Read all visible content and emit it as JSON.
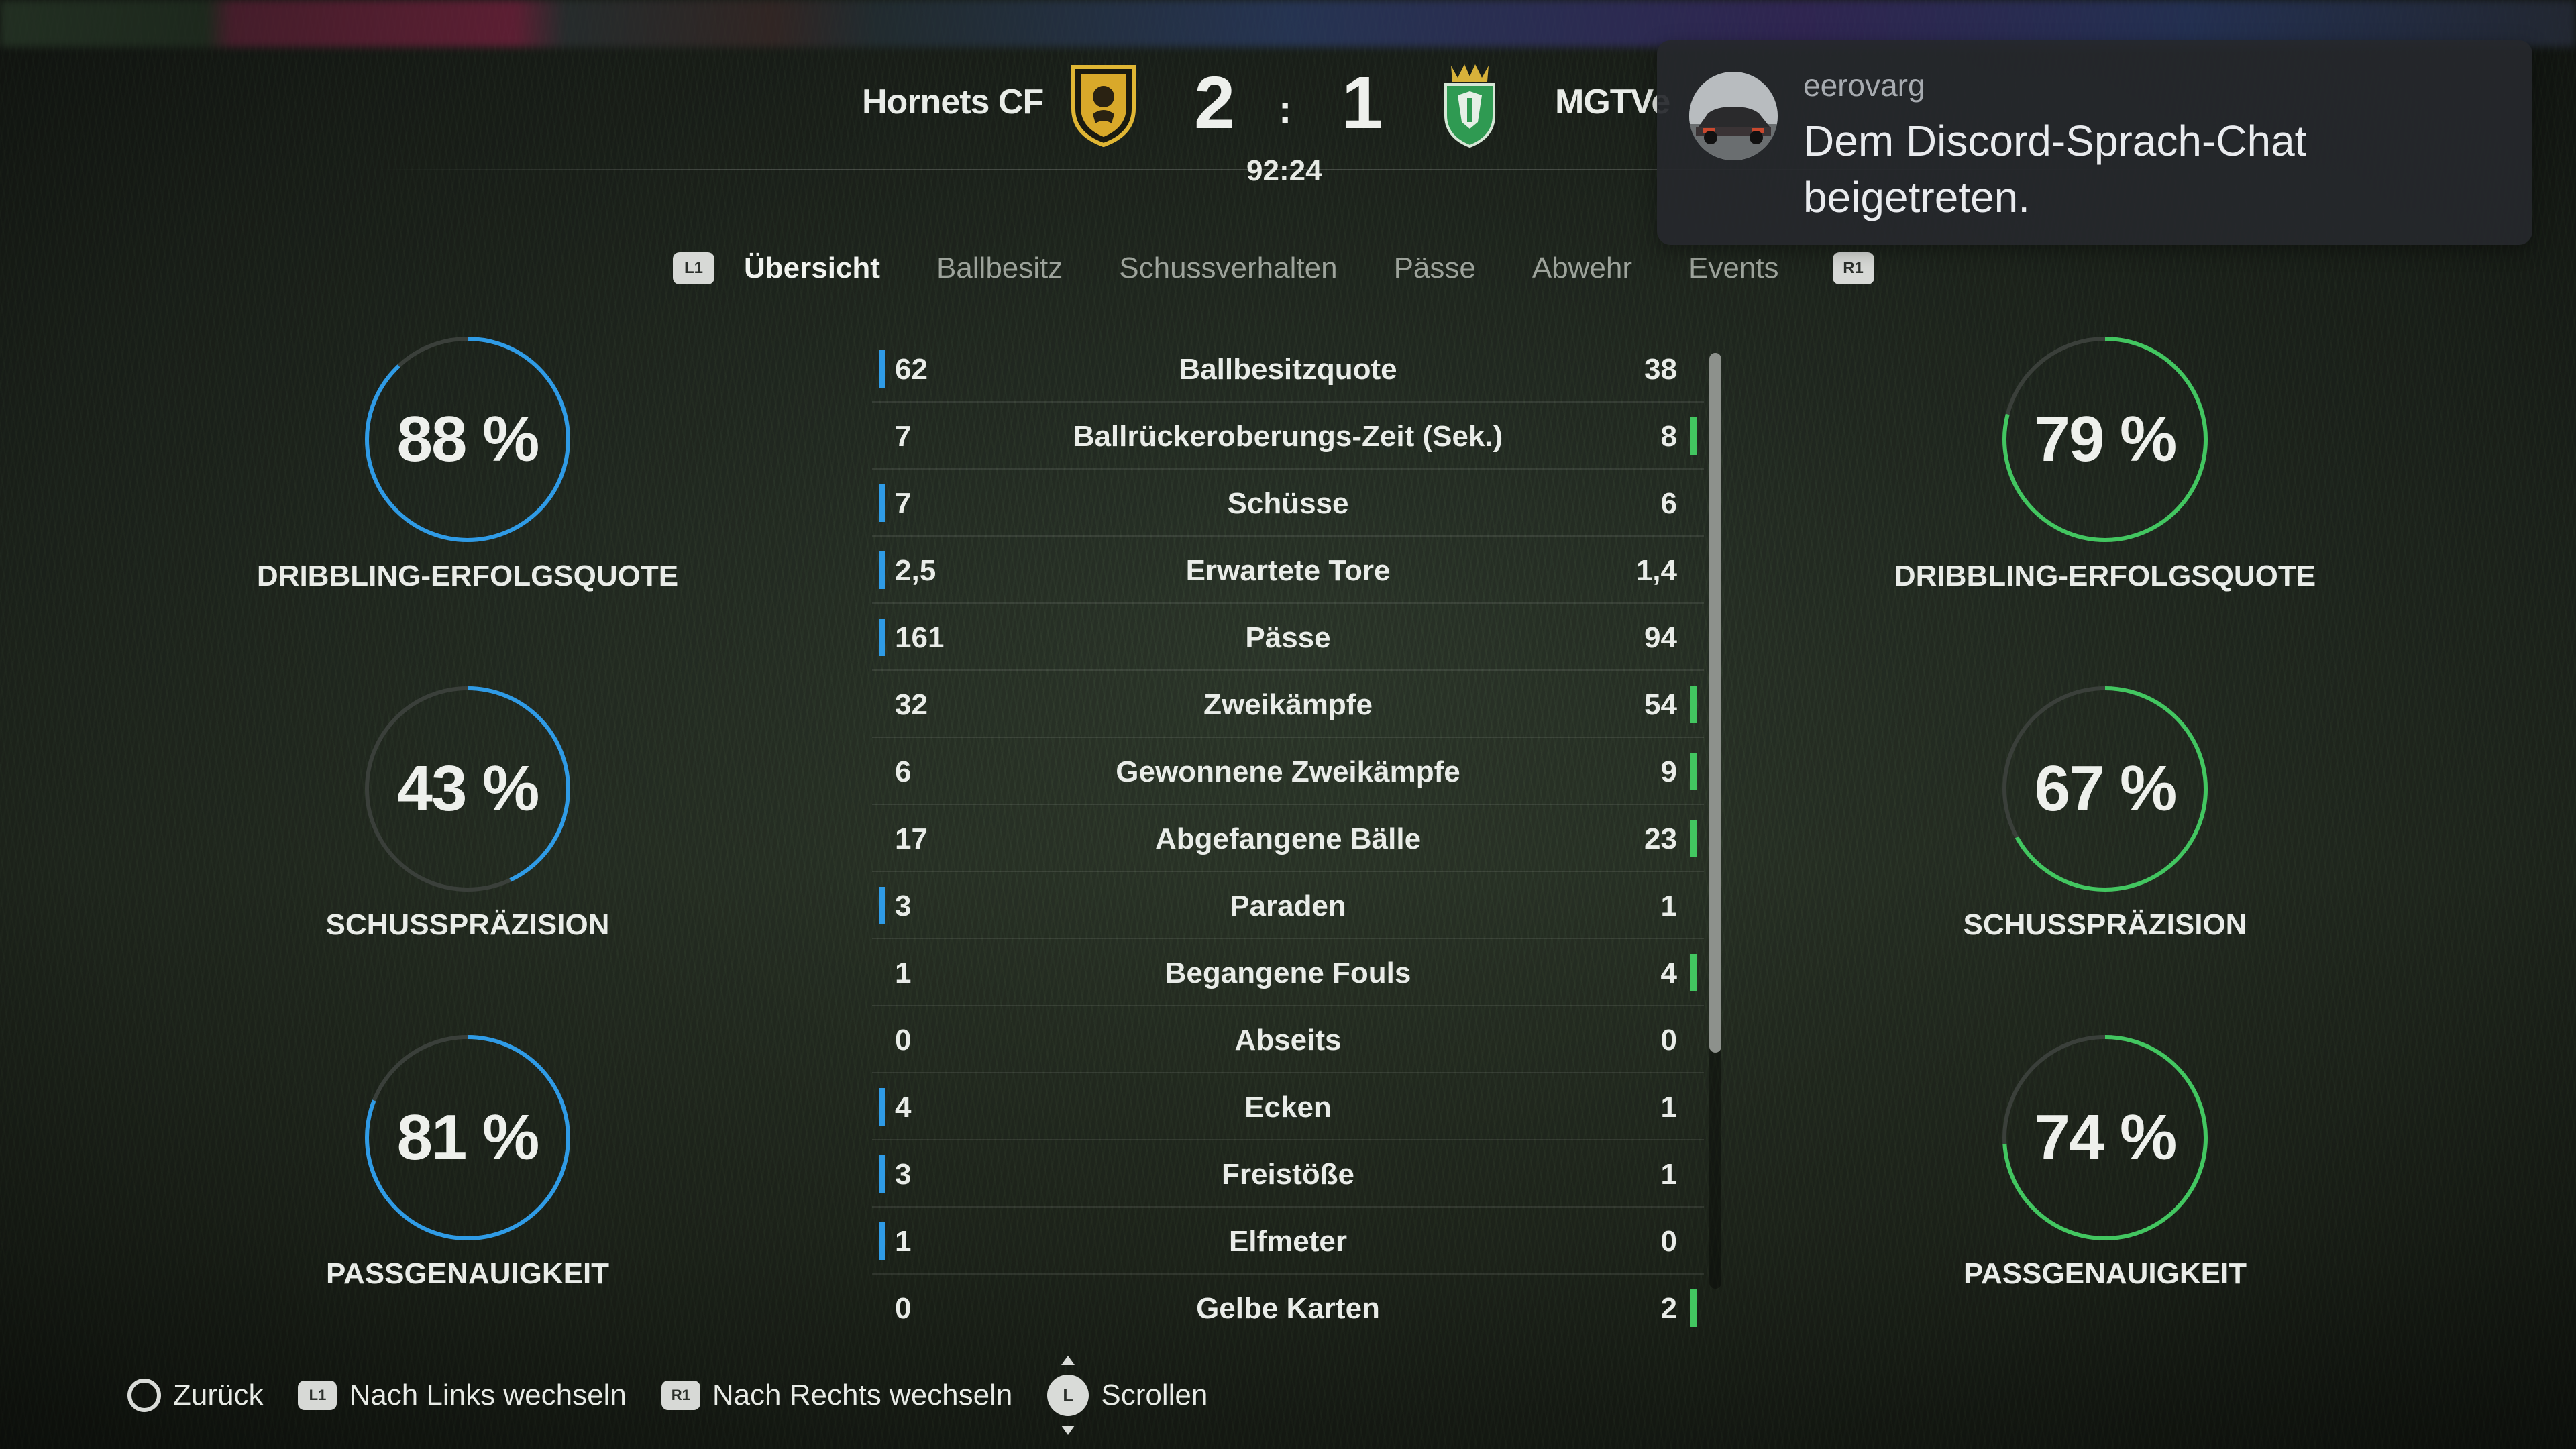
{
  "match": {
    "home_team": "Hornets CF",
    "away_team": "MGTVe",
    "home_score": "2",
    "separator": ":",
    "away_score": "1",
    "clock": "92:24"
  },
  "tabs": {
    "left_button": "L1",
    "right_button": "R1",
    "items": [
      "Übersicht",
      "Ballbesitz",
      "Schussverhalten",
      "Pässe",
      "Abwehr",
      "Events"
    ],
    "active_index": 0
  },
  "stats": [
    {
      "label": "Ballbesitzquote",
      "home": "62",
      "away": "38",
      "leader": "home"
    },
    {
      "label": "Ballrückeroberungs-Zeit (Sek.)",
      "home": "7",
      "away": "8",
      "leader": "away"
    },
    {
      "label": "Schüsse",
      "home": "7",
      "away": "6",
      "leader": "home"
    },
    {
      "label": "Erwartete Tore",
      "home": "2,5",
      "away": "1,4",
      "leader": "home"
    },
    {
      "label": "Pässe",
      "home": "161",
      "away": "94",
      "leader": "home"
    },
    {
      "label": "Zweikämpfe",
      "home": "32",
      "away": "54",
      "leader": "away"
    },
    {
      "label": "Gewonnene Zweikämpfe",
      "home": "6",
      "away": "9",
      "leader": "away"
    },
    {
      "label": "Abgefangene Bälle",
      "home": "17",
      "away": "23",
      "leader": "away"
    },
    {
      "label": "Paraden",
      "home": "3",
      "away": "1",
      "leader": "home"
    },
    {
      "label": "Begangene Fouls",
      "home": "1",
      "away": "4",
      "leader": "away"
    },
    {
      "label": "Abseits",
      "home": "0",
      "away": "0",
      "leader": "none"
    },
    {
      "label": "Ecken",
      "home": "4",
      "away": "1",
      "leader": "home"
    },
    {
      "label": "Freistöße",
      "home": "3",
      "away": "1",
      "leader": "home"
    },
    {
      "label": "Elfmeter",
      "home": "1",
      "away": "0",
      "leader": "home"
    },
    {
      "label": "Gelbe Karten",
      "home": "0",
      "away": "2",
      "leader": "away"
    }
  ],
  "rings": {
    "home": [
      {
        "pct": "88 %",
        "value": 0.88,
        "label": "DRIBBLING-ERFOLGSQUOTE"
      },
      {
        "pct": "43 %",
        "value": 0.43,
        "label": "SCHUSSPRÄZISION"
      },
      {
        "pct": "81 %",
        "value": 0.81,
        "label": "PASSGENAUIGKEIT"
      }
    ],
    "away": [
      {
        "pct": "79 %",
        "value": 0.79,
        "label": "DRIBBLING-ERFOLGSQUOTE"
      },
      {
        "pct": "67 %",
        "value": 0.67,
        "label": "SCHUSSPRÄZISION"
      },
      {
        "pct": "74 %",
        "value": 0.74,
        "label": "PASSGENAUIGKEIT"
      }
    ]
  },
  "notification": {
    "username": "eerovarg",
    "message": "Dem Discord-Sprach-Chat beigetreten."
  },
  "footer": {
    "back": "Zurück",
    "l1_badge": "L1",
    "l1_label": "Nach Links wechseln",
    "r1_badge": "R1",
    "r1_label": "Nach Rechts wechseln",
    "stick_badge": "L",
    "scroll_label": "Scrollen"
  },
  "colors": {
    "home_accent": "#2f9be6",
    "away_accent": "#42c660",
    "ring_track": "#3a3f3a"
  },
  "icons": {
    "home_crest": "gold-lion-shield-icon",
    "away_crest": "green-crowned-shield-icon",
    "notification_avatar": "car-avatar-icon"
  }
}
